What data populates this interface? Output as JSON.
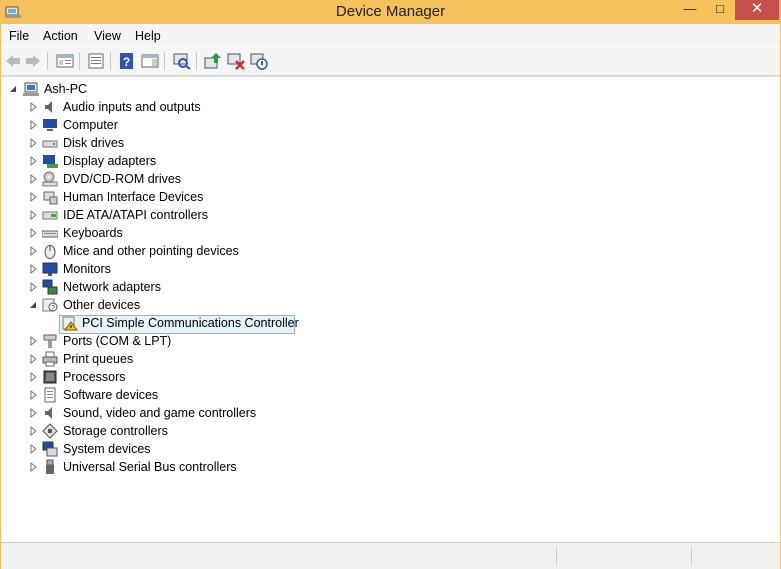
{
  "window": {
    "title": "Device Manager",
    "accent": "#f4c15a",
    "close_color": "#c7504b"
  },
  "titlebar_buttons": {
    "minimize": "—",
    "maximize": "□",
    "close": "✕"
  },
  "menu": [
    "File",
    "Action",
    "View",
    "Help"
  ],
  "toolbar": [
    "back-icon",
    "forward-icon",
    "show-hide-console-tree-icon",
    "properties-icon",
    "help-icon",
    "action-pane-icon",
    "scan-hardware-icon",
    "update-driver-icon",
    "uninstall-icon",
    "disable-device-icon"
  ],
  "tree": {
    "root": "Ash-PC",
    "categories": [
      "Audio inputs and outputs",
      "Computer",
      "Disk drives",
      "Display adapters",
      "DVD/CD-ROM drives",
      "Human Interface Devices",
      "IDE ATA/ATAPI controllers",
      "Keyboards",
      "Mice and other pointing devices",
      "Monitors",
      "Network adapters",
      "Other devices",
      "PCI Simple Communications Controller",
      "Ports (COM & LPT)",
      "Print queues",
      "Processors",
      "Software devices",
      "Sound, video and game controllers",
      "Storage controllers",
      "System devices",
      "Universal Serial Bus controllers"
    ]
  }
}
